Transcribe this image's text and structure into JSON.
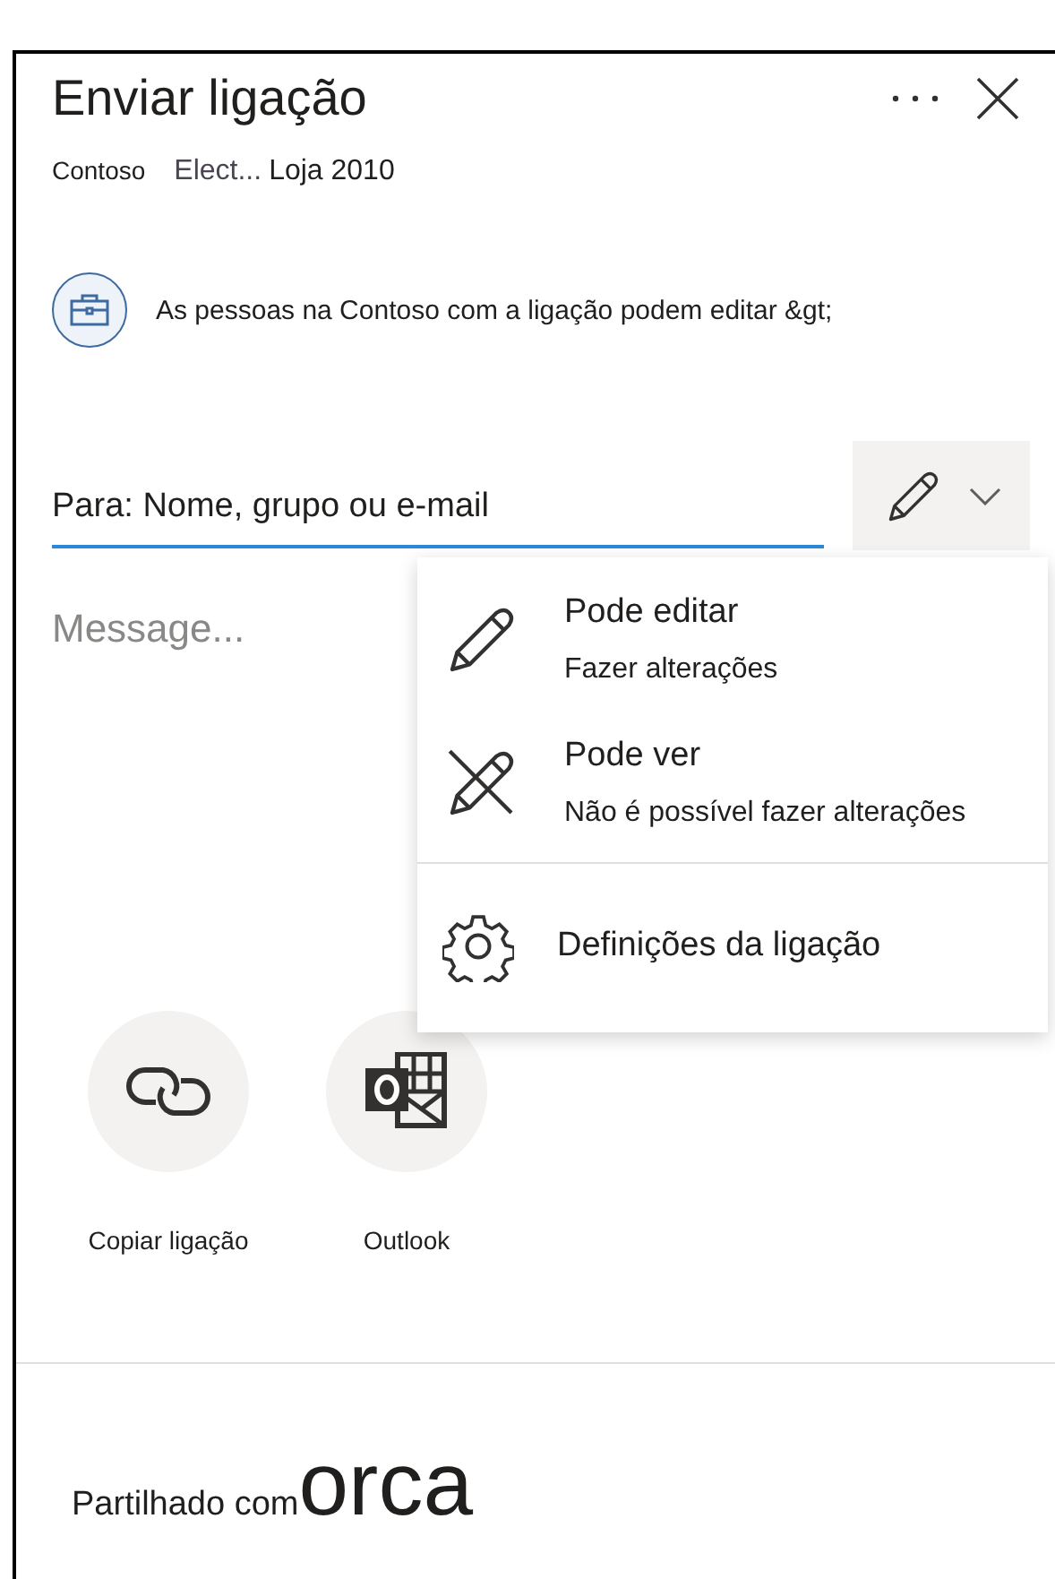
{
  "header": {
    "title": "Enviar ligação"
  },
  "breadcrumb": {
    "site": "Contoso",
    "folder": "Elect...",
    "file": "Loja 2010"
  },
  "link_scope": {
    "text": "As pessoas na Contoso com a ligação podem editar &gt;"
  },
  "recipient_field": {
    "placeholder": "Para: Nome, grupo ou e-mail"
  },
  "message_field": {
    "placeholder": "Message..."
  },
  "permission_menu": {
    "expanded": true,
    "items": [
      {
        "kind": "edit",
        "title": "Pode editar",
        "subtitle": "Fazer alterações"
      },
      {
        "kind": "view",
        "title": "Pode ver",
        "subtitle": "Não é possível fazer alterações"
      },
      {
        "kind": "settings",
        "title": "Definições da ligação"
      }
    ]
  },
  "share_targets": [
    {
      "kind": "copy-link",
      "label": "Copiar ligação"
    },
    {
      "kind": "outlook",
      "label": "Outlook"
    }
  ],
  "shared_with": {
    "label": "Partilhado com",
    "overlay_text": "orca"
  }
}
